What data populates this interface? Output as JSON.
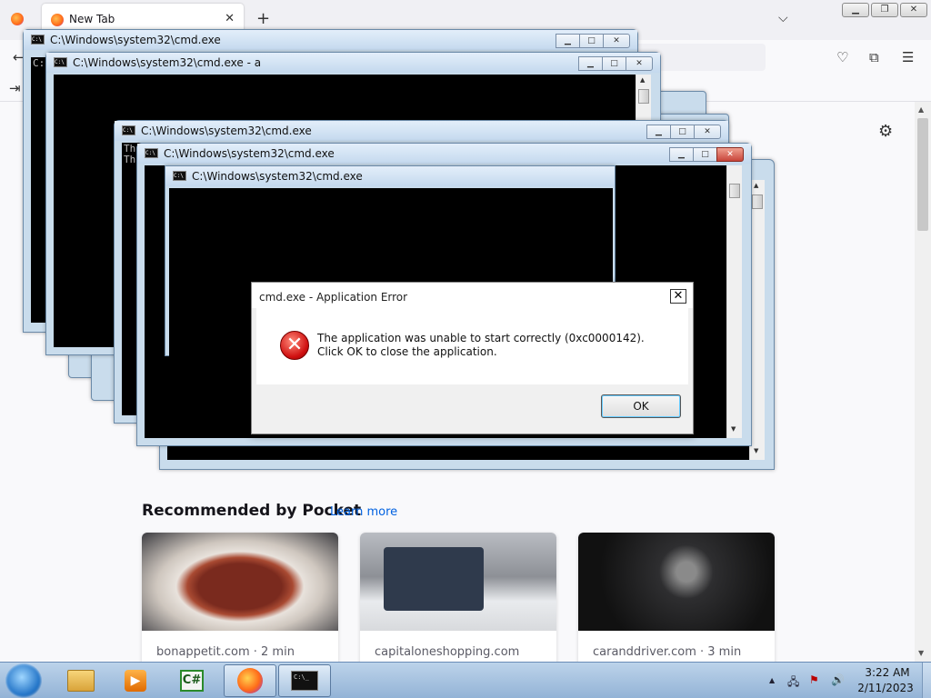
{
  "browser": {
    "tab_title": "New Tab",
    "tab_close": "✕",
    "new_tab": "+",
    "list_tabs": "⌵",
    "window_minimize": "▁",
    "window_restore": "❐",
    "window_close": "✕",
    "nav_back": "←",
    "sidebar_toggle": "⇥",
    "pocket_icon": "♡",
    "extensions_icon": "⧉",
    "menu_icon": "☰",
    "settings_icon": "⚙",
    "pocket_heading": "Recommended by Pocket",
    "learn_more": "Learn more",
    "cards": [
      {
        "source": "bonappetit.com · 2 min"
      },
      {
        "source": "capitaloneshopping.com"
      },
      {
        "source": "caranddriver.com · 3 min"
      }
    ]
  },
  "cmd_windows": [
    {
      "title": "C:\\Windows\\system32\\cmd.exe",
      "text": "C:"
    },
    {
      "title": "C:\\Windows\\system32\\cmd.exe - a",
      "text": ""
    },
    {
      "title": "C:\\Windows\\system32\\cmd.exe",
      "text": "Th\nTh"
    },
    {
      "title": "C:\\Windows\\system32\\cmd.exe",
      "text": ""
    },
    {
      "title": "C:\\Windows\\system32\\cmd.exe",
      "text": ""
    }
  ],
  "cmd_buttons": {
    "minimize": "▁",
    "maximize": "□",
    "close": "✕"
  },
  "dialog": {
    "title": "cmd.exe - Application Error",
    "close": "✕",
    "error_icon": "✕",
    "message": "The application was unable to start correctly (0xc0000142). Click OK to close the application.",
    "ok": "OK"
  },
  "taskbar": {
    "media_glyph": "▶",
    "csharp_glyph": "C#",
    "cmd_glyph": "C:\\_",
    "tray_arrow": "▲",
    "time": "3:22 AM",
    "date": "2/11/2023"
  },
  "colors": {
    "accent_link": "#0061e0",
    "error_red": "#d01010",
    "taskbar": "#93b3d6"
  }
}
